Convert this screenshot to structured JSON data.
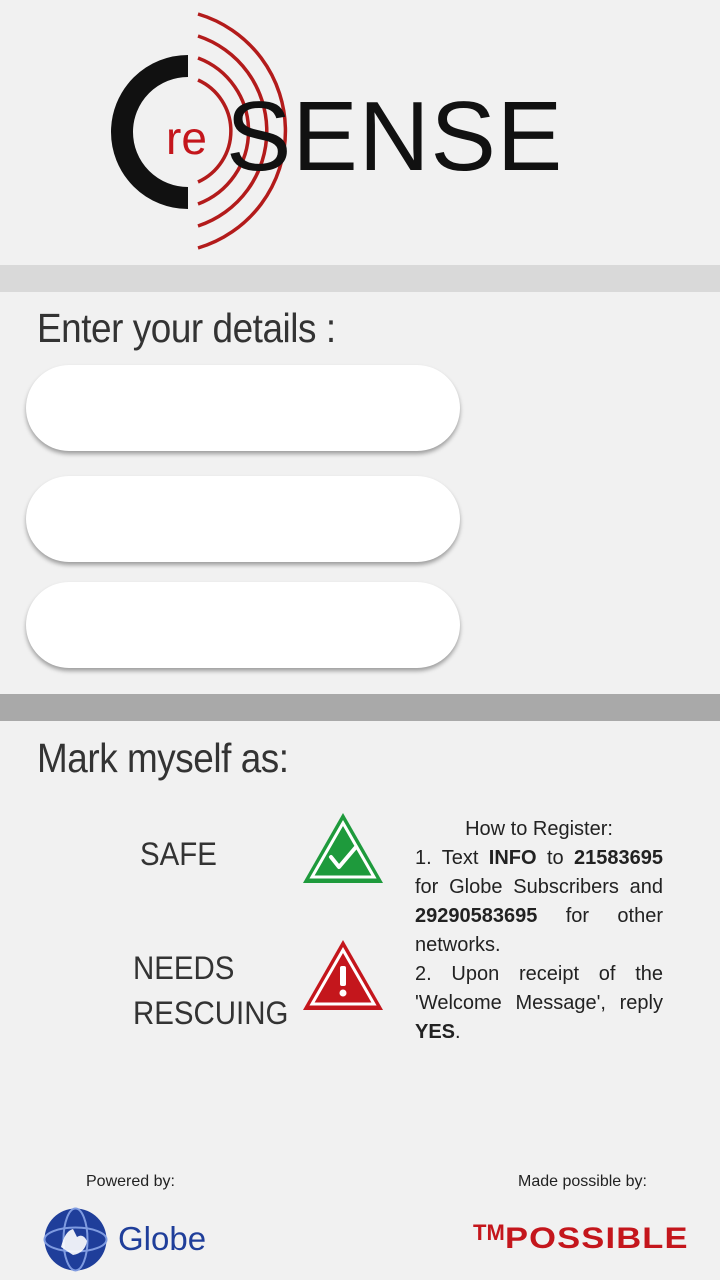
{
  "app": {
    "logo_prefix": "re",
    "logo_main": "SENSE"
  },
  "details": {
    "title": "Enter your details :",
    "fields": [
      {
        "value": "",
        "placeholder": ""
      },
      {
        "value": "",
        "placeholder": ""
      },
      {
        "value": "",
        "placeholder": ""
      }
    ]
  },
  "mark": {
    "title": "Mark myself as:",
    "safe_label": "SAFE",
    "rescue_label_line1": "NEEDS",
    "rescue_label_line2": "RESCUING",
    "safe_icon": "check-triangle-icon",
    "rescue_icon": "warning-triangle-icon",
    "safe_color": "#1e9a3c",
    "rescue_color": "#c4161c"
  },
  "register": {
    "title": "How to Register:",
    "step1_a": "1. Text ",
    "step1_keyword": "INFO",
    "step1_b": " to ",
    "step1_globe_number": "21583695",
    "step1_c": " for Globe Subscribers and ",
    "step1_other_number": "29290583695",
    "step1_d": " for other networks.",
    "step2_a": "2. Upon receipt of the 'Welcome Message', reply ",
    "step2_keyword": "YES",
    "step2_b": "."
  },
  "footer": {
    "powered_by": "Powered by:",
    "powered_brand": "Globe",
    "made_possible_by": "Made possible by:",
    "made_brand_tm": "TM",
    "made_brand": "POSSIBLE"
  },
  "colors": {
    "accent_red": "#c4161c",
    "globe_blue": "#1f3e9a"
  }
}
